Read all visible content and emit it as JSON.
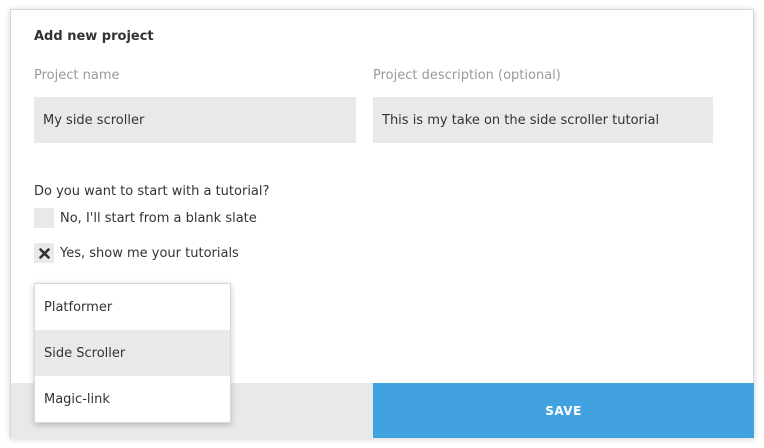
{
  "dialog": {
    "title": "Add new project"
  },
  "fields": {
    "name": {
      "label": "Project name",
      "value": "My side scroller"
    },
    "description": {
      "label": "Project description (optional)",
      "value": "This is my take on the side scroller tutorial"
    }
  },
  "tutorial": {
    "question": "Do you want to start with a tutorial?",
    "options": [
      {
        "label": "No, I'll start from a blank slate",
        "checked": false
      },
      {
        "label": "Yes, show me your tutorials",
        "checked": true
      }
    ]
  },
  "dropdown": {
    "items": [
      {
        "label": "Platformer",
        "selected": false
      },
      {
        "label": "Side Scroller",
        "selected": true
      },
      {
        "label": "Magic-link",
        "selected": false
      }
    ]
  },
  "footer": {
    "save_label": "SAVE"
  },
  "colors": {
    "accent": "#42a2e0",
    "field_bg": "#e8e9ea",
    "text": "#333333",
    "muted": "#9a9a9a"
  },
  "icons": {
    "checked_mark": "close-x-icon"
  }
}
